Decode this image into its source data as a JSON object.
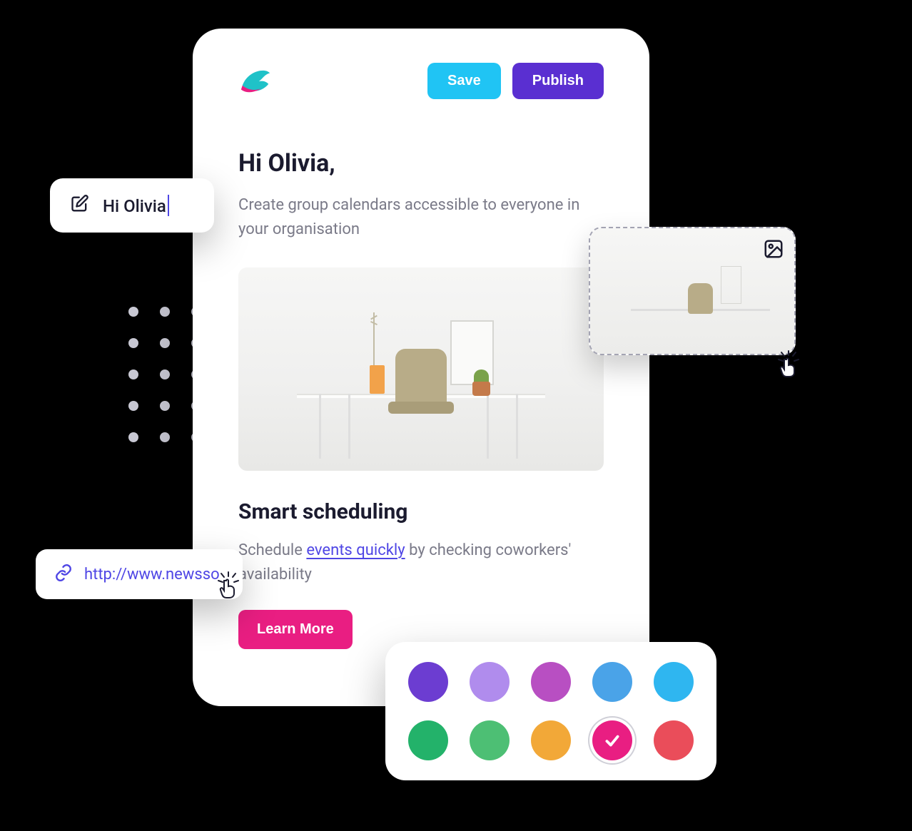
{
  "toolbar": {
    "save_label": "Save",
    "publish_label": "Publish"
  },
  "content": {
    "greeting": "Hi Olivia,",
    "sub": "Create group calendars accessible to everyone in your organisation",
    "section_title": "Smart scheduling",
    "section_body_before": "Schedule ",
    "section_link_text": "events quickly",
    "section_body_after": " by checking coworkers' availability",
    "learn_more": "Learn More"
  },
  "edit_chip": {
    "text": "Hi Olivia"
  },
  "link_pill": {
    "url": "http://www.newsso"
  },
  "palette": {
    "selected_index": 8,
    "colors": [
      "#6c3dd1",
      "#b08ced",
      "#b84fc2",
      "#4aa3e8",
      "#2fb6f0",
      "#23b26a",
      "#4dbf74",
      "#f2a838",
      "#e91e82",
      "#ea4d5a"
    ]
  },
  "icons": {
    "logo": "bird-logo",
    "edit": "edit-icon",
    "link": "link-icon",
    "image": "image-icon",
    "check": "check-icon",
    "click": "pointer-click-icon"
  }
}
